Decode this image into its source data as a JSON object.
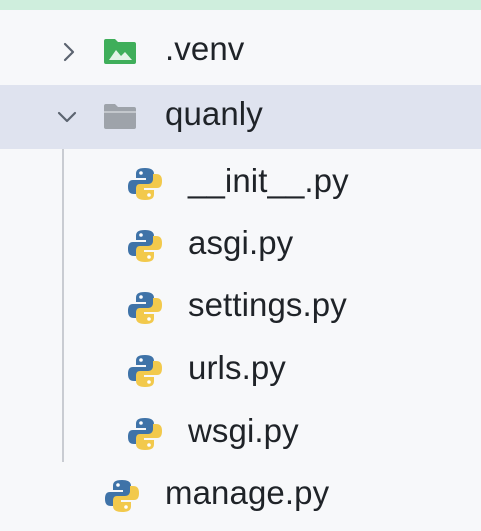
{
  "tree": {
    "items": [
      {
        "label": ".venv",
        "icon": "folder-venv-icon",
        "expanded": false
      },
      {
        "label": "quanly",
        "icon": "folder-icon",
        "expanded": true
      },
      {
        "label": "__init__.py",
        "icon": "python-file-icon"
      },
      {
        "label": "asgi.py",
        "icon": "python-file-icon"
      },
      {
        "label": "settings.py",
        "icon": "python-file-icon"
      },
      {
        "label": "urls.py",
        "icon": "python-file-icon"
      },
      {
        "label": "wsgi.py",
        "icon": "python-file-icon"
      },
      {
        "label": "manage.py",
        "icon": "python-file-icon"
      }
    ]
  },
  "colors": {
    "selection": "#dfe3ef",
    "venv_folder": "#3fae5a",
    "folder": "#9ea3aa",
    "python_blue": "#3f73a8",
    "python_yellow": "#f2c94c",
    "guide": "#c9ccd2",
    "top_strip": "#cfeedd"
  }
}
